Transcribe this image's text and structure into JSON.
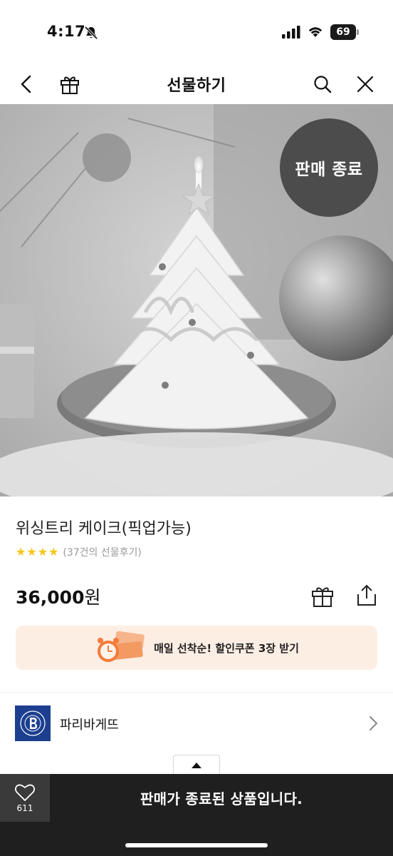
{
  "status_bar": {
    "time": "4:17",
    "battery": "69"
  },
  "nav": {
    "title": "선물하기"
  },
  "hero": {
    "sold_badge": "판매 종료"
  },
  "product": {
    "name": "위싱트리 케이크(픽업가능)",
    "rating_stars": 4,
    "review_count": "(37건의 선물후기)",
    "price": "36,000",
    "price_unit": "원"
  },
  "coupon": {
    "text": "매일 선착순! 할인쿠폰 3장 받기"
  },
  "brand": {
    "name": "파리바게뜨"
  },
  "bottom_bar": {
    "like_count": "611",
    "message": "판매가 종료된 상품입니다."
  },
  "colors": {
    "star": "#f5c518",
    "badge_bg": "#4c4c4c",
    "coupon_bg": "#fdeee4",
    "brand_logo_bg": "#1c3f8f",
    "bottom_bar_bg": "#1f1f1f"
  }
}
